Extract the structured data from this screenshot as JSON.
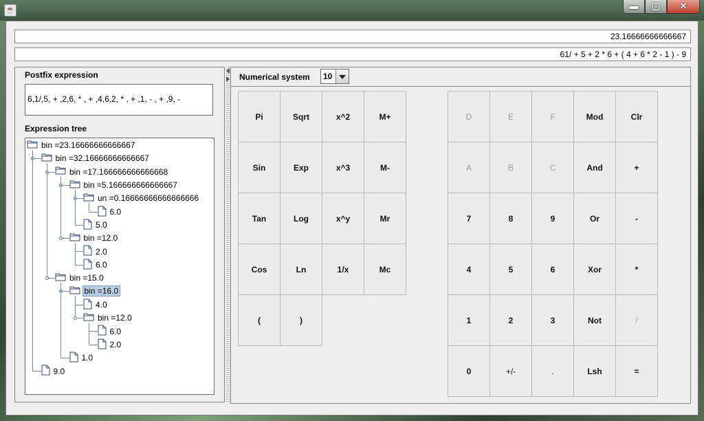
{
  "window": {
    "icon": "java-icon",
    "minimize": "▬",
    "maximize": "▢",
    "close": "✕"
  },
  "display": {
    "result": "23.16666666666667",
    "expression": "61/ + 5 + 2 * 6 +  ( 4 + 6 * 2 - 1 )  - 9"
  },
  "left": {
    "postfix_label": "Postfix expression",
    "postfix_value": "6,1/,5, + ,2,6, * , + ,4,6,2, * , + ,1, - , + ,9, -",
    "tree_label": "Expression tree",
    "tree": [
      {
        "label": "bin =23.16666666666667",
        "type": "folder",
        "depth": 0
      },
      {
        "label": "bin =32.16666666666667",
        "type": "folder",
        "depth": 1
      },
      {
        "label": "bin =17.166666666666668",
        "type": "folder",
        "depth": 2
      },
      {
        "label": "bin =5.166666666666667",
        "type": "folder",
        "depth": 3
      },
      {
        "label": "un =0.16666666666666666",
        "type": "folder",
        "depth": 4
      },
      {
        "label": "6.0",
        "type": "leaf",
        "depth": 5
      },
      {
        "label": "5.0",
        "type": "leaf",
        "depth": 4
      },
      {
        "label": "bin =12.0",
        "type": "folder",
        "depth": 3
      },
      {
        "label": "2.0",
        "type": "leaf",
        "depth": 4
      },
      {
        "label": "6.0",
        "type": "leaf",
        "depth": 4
      },
      {
        "label": "bin =15.0",
        "type": "folder",
        "depth": 2
      },
      {
        "label": "bin =16.0",
        "type": "folder",
        "depth": 3,
        "selected": true
      },
      {
        "label": "4.0",
        "type": "leaf",
        "depth": 4
      },
      {
        "label": "bin =12.0",
        "type": "folder",
        "depth": 4
      },
      {
        "label": "6.0",
        "type": "leaf",
        "depth": 5
      },
      {
        "label": "2.0",
        "type": "leaf",
        "depth": 5
      },
      {
        "label": "1.0",
        "type": "leaf",
        "depth": 3
      },
      {
        "label": "9.0",
        "type": "leaf",
        "depth": 1
      }
    ]
  },
  "right": {
    "numsys_label": "Numerical system",
    "numsys_value": "10",
    "left_keys": [
      [
        "Pi",
        "Sqrt",
        "x^2",
        "M+"
      ],
      [
        "Sin",
        "Exp",
        "x^3",
        "M-"
      ],
      [
        "Tan",
        "Log",
        "x^y",
        "Mr"
      ],
      [
        "Cos",
        "Ln",
        "1/x",
        "Mc"
      ],
      [
        "(",
        ")",
        "",
        ""
      ]
    ],
    "right_keys": [
      [
        "D",
        "E",
        "F",
        "Mod",
        "Clr"
      ],
      [
        "A",
        "B",
        "C",
        "And",
        "+"
      ],
      [
        "7",
        "8",
        "9",
        "Or",
        "-"
      ],
      [
        "4",
        "5",
        "6",
        "Xor",
        "*"
      ],
      [
        "1",
        "2",
        "3",
        "Not",
        "/"
      ],
      [
        "0",
        "+/-",
        ".",
        "Lsh",
        "="
      ]
    ],
    "disabled_keys": [
      "D",
      "E",
      "F",
      "A",
      "B",
      "C",
      "/"
    ],
    "regular_weight_keys": [
      "+/-",
      "."
    ]
  }
}
